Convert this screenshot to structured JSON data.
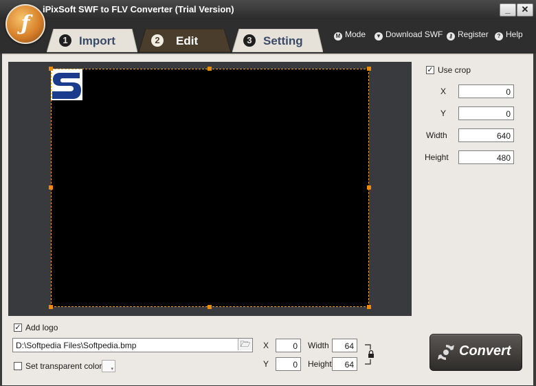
{
  "window": {
    "title": "iPixSoft SWF to FLV Converter (Trial Version)",
    "minimize_label": "_",
    "close_label": "✕"
  },
  "tabs": [
    {
      "number": "1",
      "label": "Import",
      "active": false
    },
    {
      "number": "2",
      "label": "Edit",
      "active": true
    },
    {
      "number": "3",
      "label": "Setting",
      "active": false
    }
  ],
  "toplinks": {
    "mode": "Mode",
    "download": "Download SWF",
    "register": "Register",
    "help": "Help"
  },
  "crop": {
    "use_crop_label": "Use crop",
    "use_crop_checked": true,
    "x_label": "X",
    "x_value": "0",
    "y_label": "Y",
    "y_value": "0",
    "width_label": "Width",
    "width_value": "640",
    "height_label": "Height",
    "height_value": "480"
  },
  "logo": {
    "add_logo_label": "Add logo",
    "add_logo_checked": true,
    "path": "D:\\Softpedia Files\\Softpedia.bmp",
    "transparent_label": "Set transparent color",
    "transparent_checked": false,
    "x_label": "X",
    "x_value": "0",
    "y_label": "Y",
    "y_value": "0",
    "width_label": "Width",
    "width_value": "64",
    "height_label": "Height",
    "height_value": "64"
  },
  "convert_label": "Convert",
  "colors": {
    "accent_orange": "#f08a00",
    "panel_bg": "#ece9e4",
    "preview_bg": "#383a3e",
    "logo_blue": "#1b3c8c"
  },
  "icons": {
    "app": "flash-logo-icon",
    "mode": "mode-icon",
    "download": "download-icon",
    "register": "key-icon",
    "help": "help-icon",
    "browse": "folder-open-icon",
    "lock": "lock-icon",
    "convert": "refresh-arrows-icon"
  }
}
